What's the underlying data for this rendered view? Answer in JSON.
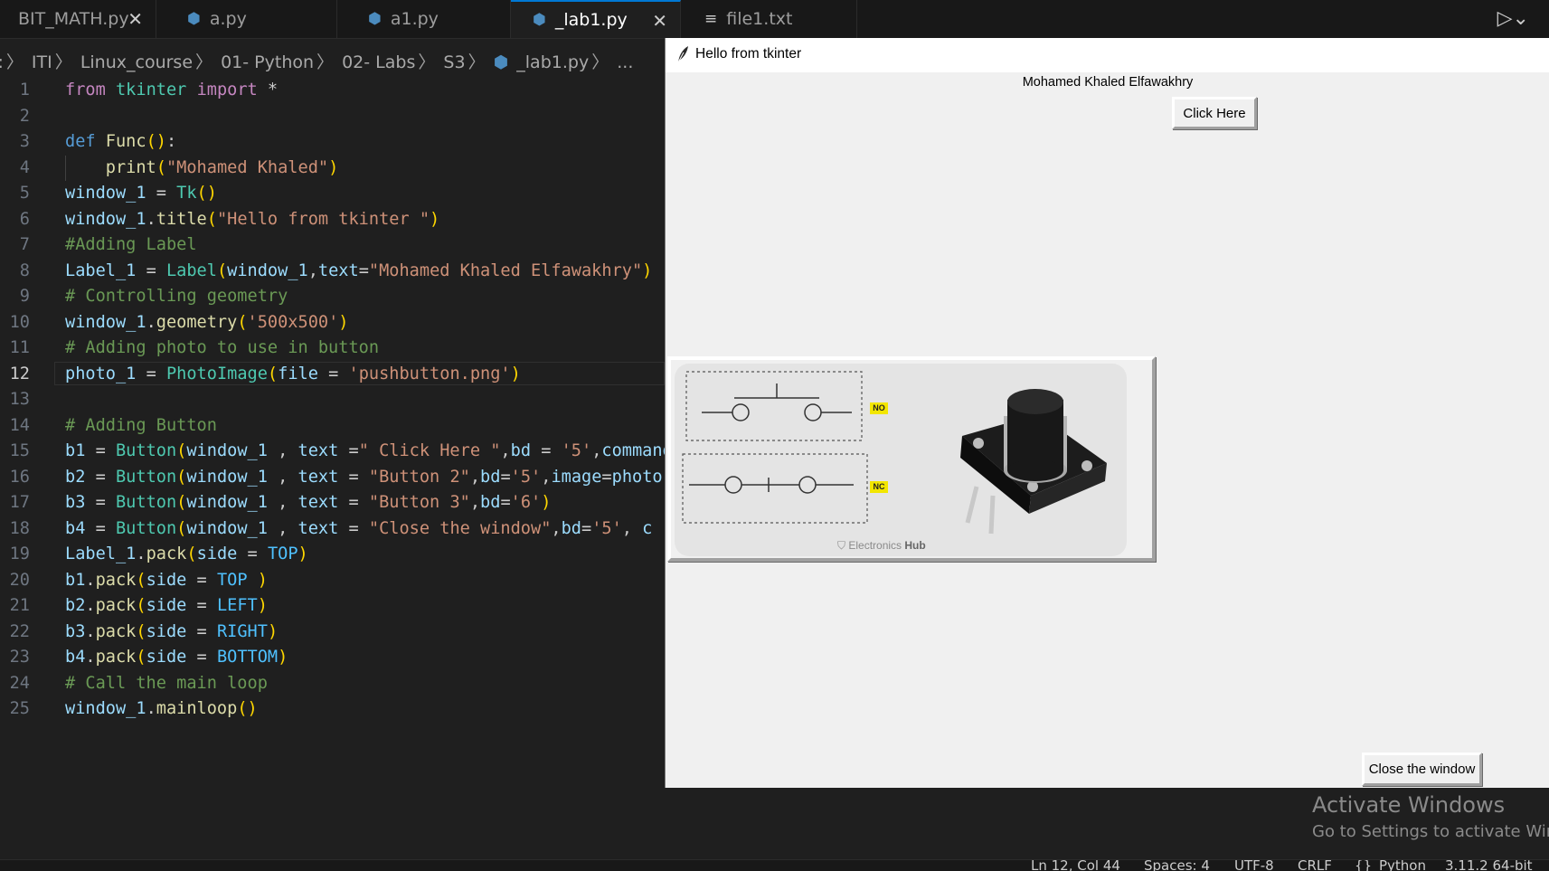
{
  "editor": {
    "tabs": [
      {
        "label": "BIT_MATH.py",
        "close": "✕"
      },
      {
        "label": "a.py"
      },
      {
        "label": "a1.py"
      },
      {
        "label": "_lab1.py",
        "close": "✕"
      },
      {
        "label": "file1.txt"
      }
    ],
    "breadcrumb": [
      "F:",
      "ITI",
      "Linux_course",
      "01- Python",
      "02- Labs",
      "S3",
      "_lab1.py",
      "..."
    ],
    "current_line": 12
  },
  "tkinter": {
    "title": "Hello from tkinter",
    "label_text": "Mohamed Khaled Elfawakhry",
    "click_button": "Click Here",
    "close_button": "Close the window",
    "image": {
      "badge_no": "NO",
      "badge_nc": "NC",
      "watermark_prefix": "Electronics",
      "watermark_bold": "Hub"
    }
  },
  "watermark": {
    "title": "Activate Windows",
    "subtitle": "Go to Settings to activate Windows."
  },
  "status": {
    "position": "Ln 12, Col 44",
    "spaces": "Spaces: 4",
    "encoding": "UTF-8",
    "eol": "CRLF",
    "language": "Python",
    "interpreter": "3.11.2 64-bit"
  },
  "colors": {
    "editor_bg": "#1f1f1f",
    "tab_accent": "#0078d4",
    "tk_bg": "#f0f0f0"
  },
  "icons": [
    "python-file-icon",
    "text-file-icon",
    "run-icon",
    "tk-feather-icon",
    "close-icon"
  ]
}
